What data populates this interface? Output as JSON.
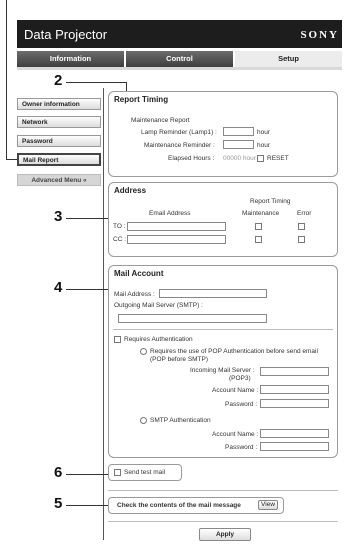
{
  "header": {
    "app_title": "Data Projector",
    "brand": "SONY"
  },
  "tabs": [
    {
      "label": "Information",
      "active": false
    },
    {
      "label": "Control",
      "active": false
    },
    {
      "label": "Setup",
      "active": true
    }
  ],
  "sidebar": {
    "items": [
      {
        "label": "Owner information"
      },
      {
        "label": "Network"
      },
      {
        "label": "Password"
      },
      {
        "label": "Mail Report",
        "selected": true
      }
    ],
    "advanced_menu": "Advanced Menu  «"
  },
  "callouts": {
    "c2": "2",
    "c3": "3",
    "c4": "4",
    "c5": "5",
    "c6": "6"
  },
  "report_timing": {
    "title": "Report Timing",
    "maintenance_report": "Maintenance Report",
    "lamp_reminder_label": "Lamp Reminder (Lamp1) :",
    "lamp_reminder_value": "",
    "lamp_unit": "hour",
    "maintenance_reminder_label": "Maintenance Reminder :",
    "maintenance_reminder_value": "",
    "maintenance_unit": "hour",
    "elapsed_label": "Elapsed Hours :",
    "elapsed_value": "00000 hour",
    "reset_label": "RESET"
  },
  "address": {
    "title": "Address",
    "email_header": "Email Address",
    "report_timing_header": "Report Timing",
    "maintenance_header": "Maintenance",
    "error_header": "Error",
    "to_label": "TO :",
    "to_value": "",
    "cc_label": "CC :",
    "cc_value": ""
  },
  "mail_account": {
    "title": "Mail Account",
    "mail_address_label": "Mail Address :",
    "mail_address_value": "",
    "smtp_label": "Outgoing Mail Server (SMTP) :",
    "smtp_value": "",
    "requires_auth": "Requires Authentication",
    "pop_auth_line1": "Requires the use of POP Authentication before send email",
    "pop_auth_line2": "(POP before SMTP)",
    "incoming_label": "Incoming Mail Server :",
    "incoming_sub": "(POP3)",
    "incoming_value": "",
    "pop_account_label": "Account Name :",
    "pop_account_value": "",
    "pop_password_label": "Password :",
    "pop_password_value": "",
    "smtp_auth": "SMTP Authentication",
    "smtp_account_label": "Account Name :",
    "smtp_account_value": "",
    "smtp_password_label": "Password :",
    "smtp_password_value": ""
  },
  "test_mail": {
    "label": "Send test mail"
  },
  "check_mail": {
    "label": "Check the contents of the mail message",
    "view_button": "View"
  },
  "apply_button": "Apply"
}
